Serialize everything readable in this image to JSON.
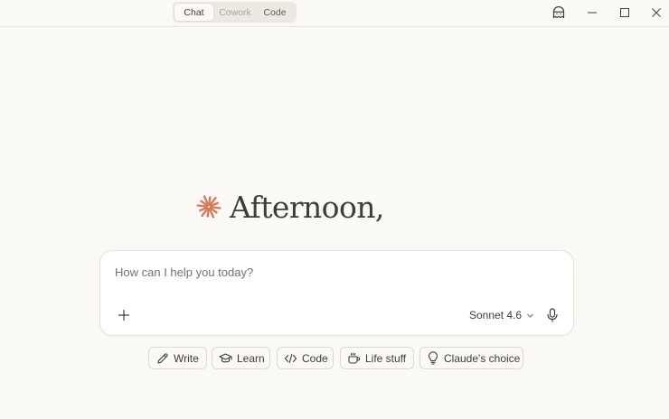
{
  "titlebar": {
    "modes": [
      {
        "label": "Chat",
        "active": true
      },
      {
        "label": "Cowork",
        "active": false
      },
      {
        "label": "Code",
        "active": false
      }
    ],
    "icons": {
      "ghost": "incognito-ghost-icon",
      "minimize": "minimize-icon",
      "maximize": "maximize-icon",
      "close": "close-icon"
    }
  },
  "greeting": {
    "text": "Afternoon,",
    "icon": "claude-starburst-icon",
    "accent_color": "#d97757"
  },
  "composer": {
    "placeholder": "How can I help you today?",
    "value": "",
    "model": "Sonnet 4.6",
    "icons": {
      "attach": "plus-icon",
      "model_dropdown": "chevron-down-icon",
      "voice": "microphone-icon"
    }
  },
  "suggestions": [
    {
      "label": "Write",
      "icon": "pencil-icon"
    },
    {
      "label": "Learn",
      "icon": "graduation-cap-icon"
    },
    {
      "label": "Code",
      "icon": "code-brackets-icon"
    },
    {
      "label": "Life stuff",
      "icon": "coffee-cup-icon"
    },
    {
      "label": "Claude's choice",
      "icon": "lightbulb-icon"
    }
  ]
}
